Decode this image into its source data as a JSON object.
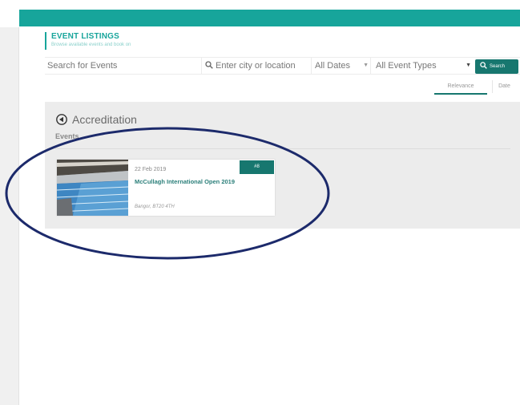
{
  "header": {
    "title": "EVENT LISTINGS",
    "subtitle": "Browse available events and book on"
  },
  "search_bar": {
    "search_placeholder": "Search for Events",
    "location_placeholder": "Enter city or location",
    "dates_value": "All Dates",
    "event_types_value": "All Event Types",
    "search_button": "Search"
  },
  "sort": {
    "relevance": "Relevance",
    "date": "Date",
    "active": "Relevance"
  },
  "category": {
    "title": "Accreditation",
    "events_label": "Events"
  },
  "events": [
    {
      "date": "22 Feb 2019",
      "name": "McCullagh International Open 2019",
      "location": "Bangor, BT20 4TH",
      "badge": "#8"
    }
  ],
  "colors": {
    "brand": "#17a59b",
    "button": "#17776f",
    "annotation": "#1c2a6b"
  }
}
